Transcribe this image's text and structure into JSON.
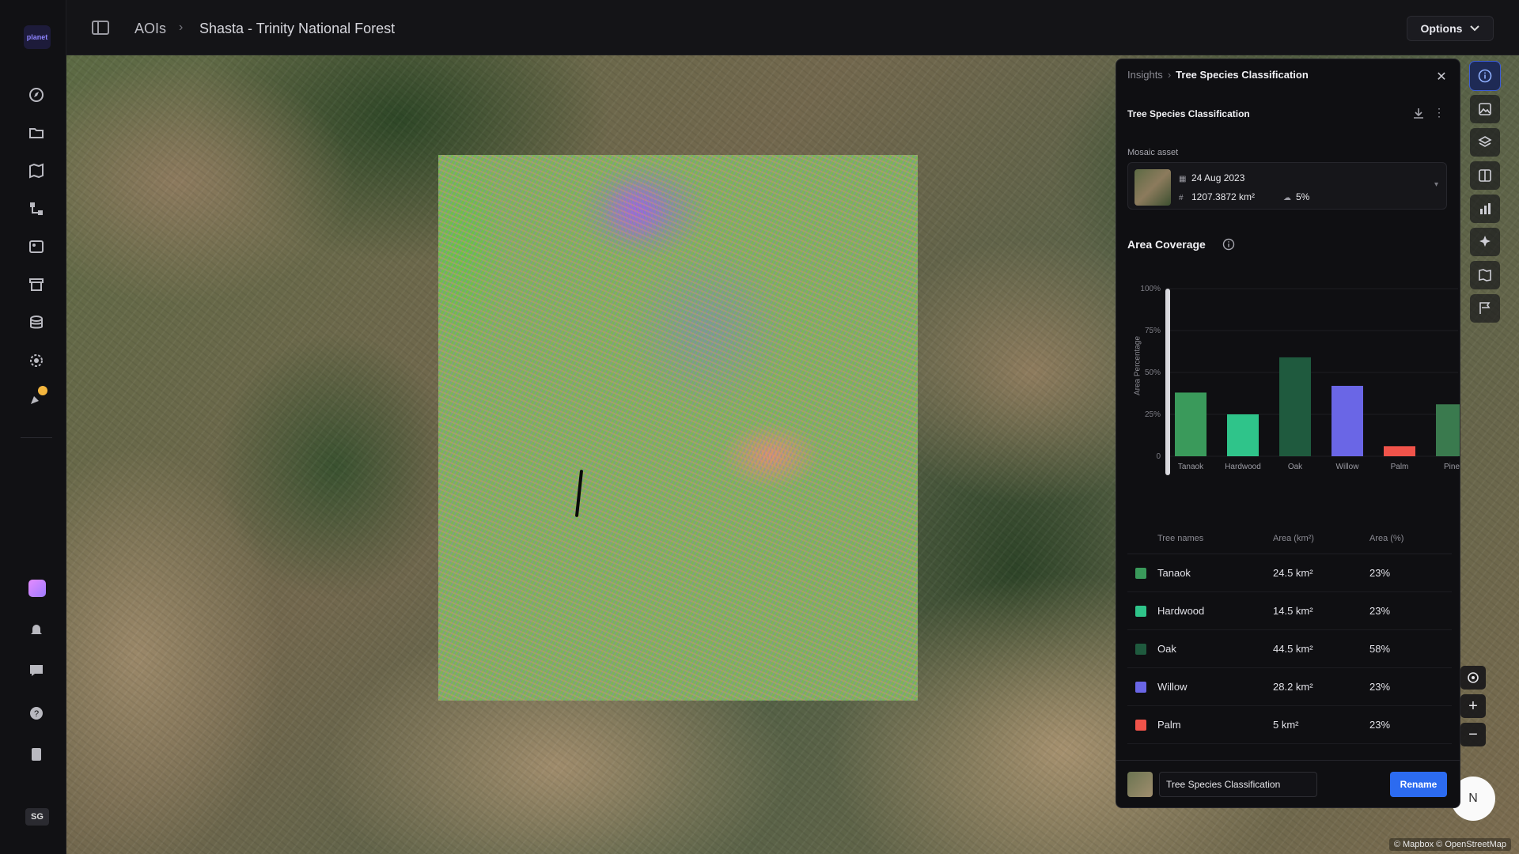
{
  "app": {
    "logo_text": "planet"
  },
  "breadcrumb": {
    "root": "AOIs",
    "separator": "›",
    "current": "Shasta - Trinity National Forest"
  },
  "topbar": {
    "options_label": "Options"
  },
  "sidebar": {
    "icons": [
      "compass-icon",
      "folder-icon",
      "map-icon",
      "workflow-icon",
      "gallery-icon",
      "store-icon",
      "database-icon",
      "settings-cog-icon",
      "notifications-icon"
    ],
    "bottom_icons": [
      "app-tile-icon",
      "bell-icon",
      "chat-icon",
      "help-icon",
      "docs-icon"
    ],
    "avatar_initials": "SG"
  },
  "panel": {
    "crumb_parent": "Insights",
    "crumb_current": "Tree Species Classification",
    "card_title": "Tree Species Classification",
    "mosaic_label": "Mosaic asset",
    "asset": {
      "date": "24 Aug 2023",
      "area": "1207.3872 km²",
      "cloud": "5%"
    },
    "coverage_title": "Area Coverage",
    "footer": {
      "name_value": "Tree Species Classification",
      "rename_label": "Rename"
    }
  },
  "chart_data": {
    "type": "bar",
    "title": "Area Coverage",
    "ylabel": "Area Percentage",
    "xlabel": "",
    "ylim": [
      0,
      100
    ],
    "yticks": [
      "0",
      "25%",
      "50%",
      "75%",
      "100%"
    ],
    "categories": [
      "Tanaok",
      "Hardwood",
      "Oak",
      "Willow",
      "Palm",
      "Pine"
    ],
    "values": [
      38,
      25,
      59,
      42,
      6,
      31
    ],
    "colors": [
      "#3a9a5b",
      "#2fc48a",
      "#1f5a3e",
      "#6a66e6",
      "#f0534a",
      "#3a7a4e"
    ]
  },
  "table": {
    "headers": [
      "Tree names",
      "Area (km²)",
      "Area (%)"
    ],
    "rows": [
      {
        "name": "Tanaok",
        "area": "24.5 km²",
        "pct": "23%",
        "color": "#3a9a5b"
      },
      {
        "name": "Hardwood",
        "area": "14.5 km²",
        "pct": "23%",
        "color": "#2fc48a"
      },
      {
        "name": "Oak",
        "area": "44.5 km²",
        "pct": "58%",
        "color": "#1f5a3e"
      },
      {
        "name": "Willow",
        "area": "28.2 km²",
        "pct": "23%",
        "color": "#6a66e6"
      },
      {
        "name": "Palm",
        "area": "5 km²",
        "pct": "23%",
        "color": "#f0534a"
      }
    ]
  },
  "map": {
    "attribution": "© Mapbox © OpenStreetMap",
    "compass_label": "N",
    "zoom_in": "+",
    "zoom_out": "−"
  },
  "right_tools": [
    "info-icon",
    "image-icon",
    "layers-icon",
    "compare-icon",
    "chart-icon",
    "ai-icon",
    "map-book-icon",
    "flag-icon"
  ]
}
